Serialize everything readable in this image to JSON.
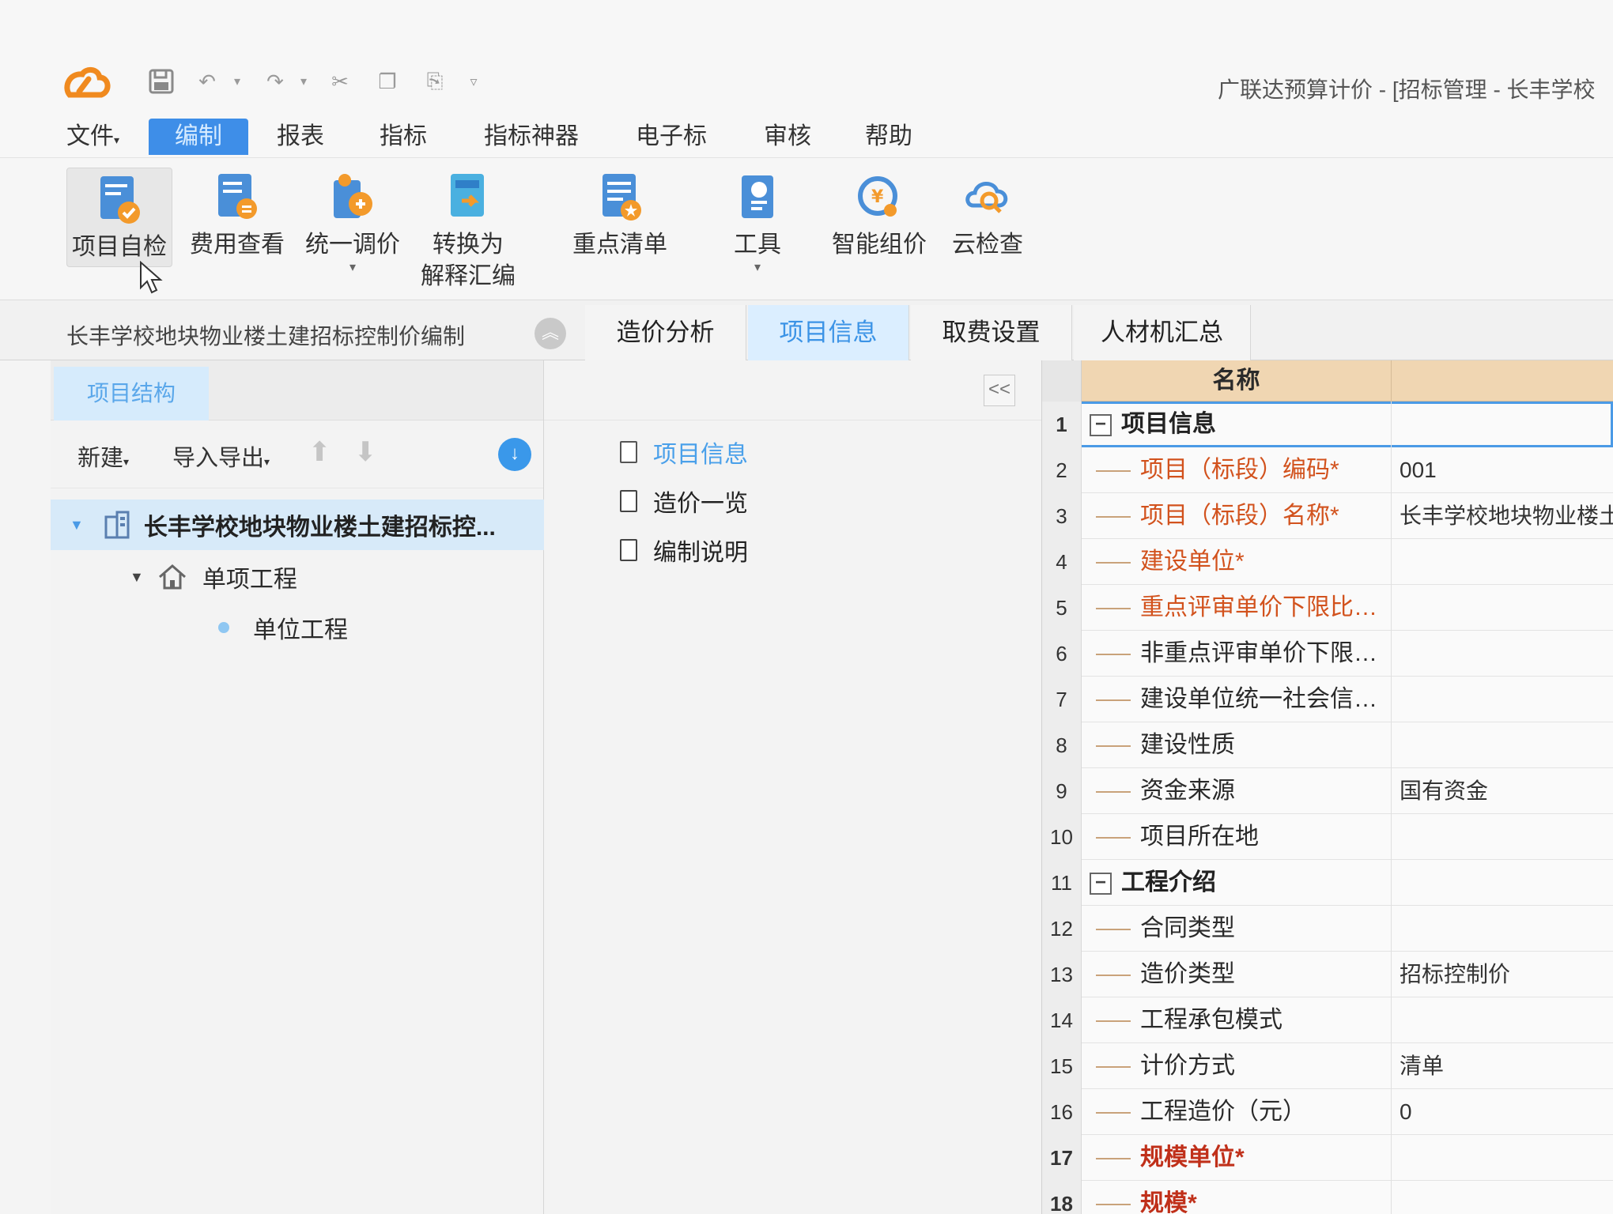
{
  "app": {
    "title": "广联达预算计价 - [招标管理 - 长丰学校"
  },
  "quick_access": [
    "save-icon",
    "undo-icon",
    "redo-icon",
    "cut-icon",
    "copy-icon",
    "paste-icon",
    "customize-icon"
  ],
  "menu": {
    "items": [
      {
        "label": "文件"
      },
      {
        "label": "编制"
      },
      {
        "label": "报表"
      },
      {
        "label": "指标"
      },
      {
        "label": "指标神器"
      },
      {
        "label": "电子标"
      },
      {
        "label": "审核"
      },
      {
        "label": "帮助"
      }
    ]
  },
  "ribbon": {
    "buttons": [
      {
        "label": "项目自检"
      },
      {
        "label": "费用查看"
      },
      {
        "label": "统一调价"
      },
      {
        "label": "转换为",
        "label2": "解释汇编"
      },
      {
        "label": "重点清单"
      },
      {
        "label": "工具"
      },
      {
        "label": "智能组价"
      },
      {
        "label": "云检查"
      }
    ]
  },
  "project_bar": {
    "title": "长丰学校地块物业楼土建招标控制价编制",
    "tabs": [
      {
        "label": "造价分析"
      },
      {
        "label": "项目信息"
      },
      {
        "label": "取费设置"
      },
      {
        "label": "人材机汇总"
      }
    ]
  },
  "left_panel": {
    "tab": "项目结构",
    "toolbar": {
      "new": "新建",
      "import_export": "导入导出"
    },
    "tree": [
      {
        "label": "长丰学校地块物业楼土建招标控..."
      },
      {
        "label": "单项工程"
      },
      {
        "label": "单位工程"
      }
    ]
  },
  "middle_panel": {
    "collapse": "<<",
    "docs": [
      {
        "label": "项目信息"
      },
      {
        "label": "造价一览"
      },
      {
        "label": "编制说明"
      }
    ]
  },
  "grid": {
    "header_name": "名称",
    "rows": [
      {
        "num": "1",
        "name": "项目信息",
        "value": ""
      },
      {
        "num": "2",
        "name": "项目（标段）编码*",
        "value": "001"
      },
      {
        "num": "3",
        "name": "项目（标段）名称*",
        "value": "长丰学校地块物业楼土"
      },
      {
        "num": "4",
        "name": "建设单位*",
        "value": ""
      },
      {
        "num": "5",
        "name": "重点评审单价下限比…",
        "value": ""
      },
      {
        "num": "6",
        "name": "非重点评审单价下限…",
        "value": ""
      },
      {
        "num": "7",
        "name": "建设单位统一社会信…",
        "value": ""
      },
      {
        "num": "8",
        "name": "建设性质",
        "value": ""
      },
      {
        "num": "9",
        "name": "资金来源",
        "value": "国有资金"
      },
      {
        "num": "10",
        "name": "项目所在地",
        "value": ""
      },
      {
        "num": "11",
        "name": "工程介绍",
        "value": ""
      },
      {
        "num": "12",
        "name": "合同类型",
        "value": ""
      },
      {
        "num": "13",
        "name": "造价类型",
        "value": "招标控制价"
      },
      {
        "num": "14",
        "name": "工程承包模式",
        "value": ""
      },
      {
        "num": "15",
        "name": "计价方式",
        "value": "清单"
      },
      {
        "num": "16",
        "name": "工程造价（元）",
        "value": "0"
      },
      {
        "num": "17",
        "name": "规模单位*",
        "value": ""
      },
      {
        "num": "18",
        "name": "规模*",
        "value": ""
      }
    ]
  },
  "colors": {
    "accent": "#3e8ee8",
    "required": "#d2521d",
    "header": "#f0d6b2"
  }
}
